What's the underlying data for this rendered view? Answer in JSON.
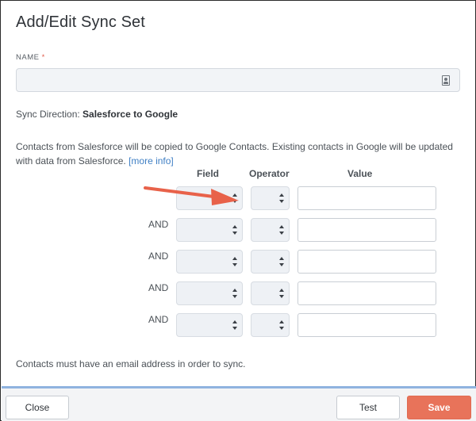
{
  "dialog": {
    "title": "Add/Edit Sync Set"
  },
  "name_field": {
    "label": "NAME",
    "required_mark": "*",
    "value": "",
    "icon": "contact-card-icon"
  },
  "sync_direction": {
    "label": "Sync Direction:",
    "value": "Salesforce to Google"
  },
  "description": {
    "text": "Contacts from Salesforce will be copied to Google Contacts. Existing contacts in Google will be updated with data from Salesforce.",
    "link": "[more info]"
  },
  "filters": {
    "headers": {
      "field": "Field",
      "operator": "Operator",
      "value": "Value"
    },
    "rows": [
      {
        "conjunction": "",
        "field": "",
        "operator": "",
        "value": ""
      },
      {
        "conjunction": "AND",
        "field": "",
        "operator": "",
        "value": ""
      },
      {
        "conjunction": "AND",
        "field": "",
        "operator": "",
        "value": ""
      },
      {
        "conjunction": "AND",
        "field": "",
        "operator": "",
        "value": ""
      },
      {
        "conjunction": "AND",
        "field": "",
        "operator": "",
        "value": ""
      }
    ]
  },
  "note": "Contacts must have an email address in order to sync.",
  "footer": {
    "close_label": "Close",
    "test_label": "Test",
    "save_label": "Save"
  },
  "colors": {
    "accent": "#e8735a",
    "link": "#3f7fc4",
    "annotation_arrow": "#e8624a",
    "footer_border": "#8fb3df"
  }
}
